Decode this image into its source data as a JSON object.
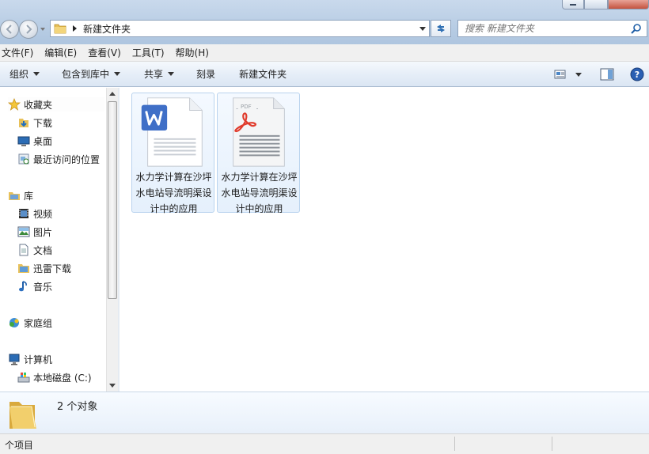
{
  "address": {
    "path": "新建文件夹"
  },
  "search": {
    "placeholder": "搜索 新建文件夹"
  },
  "menu": [
    {
      "label": "文件(F)"
    },
    {
      "label": "编辑(E)"
    },
    {
      "label": "查看(V)"
    },
    {
      "label": "工具(T)"
    },
    {
      "label": "帮助(H)"
    }
  ],
  "toolbar": {
    "organize": "组织",
    "include_library": "包含到库中",
    "share": "共享",
    "burn": "刻录",
    "new_folder": "新建文件夹"
  },
  "sidebar": {
    "favorites": "收藏夹",
    "downloads": "下载",
    "desktop": "桌面",
    "recent": "最近访问的位置",
    "libraries": "库",
    "videos": "视频",
    "pictures": "图片",
    "documents": "文档",
    "thunder": "迅雷下载",
    "music": "音乐",
    "homegroup": "家庭组",
    "computer": "计算机",
    "local_disk": "本地磁盘 (C:)"
  },
  "files": [
    {
      "name": "水力学计算在沙坪水电站导流明渠设计中的应用",
      "icon": "wps-doc-icon"
    },
    {
      "name": "水力学计算在沙坪水电站导流明渠设计中的应用",
      "icon": "pdf-doc-icon",
      "badge": "PDF"
    }
  ],
  "details": {
    "count": "2 个对象"
  },
  "status": {
    "text": "个项目"
  },
  "colors": {
    "wps_blue": "#3f6fc7",
    "pdf_red": "#e03b2c",
    "selection": "#b9d3ee"
  }
}
